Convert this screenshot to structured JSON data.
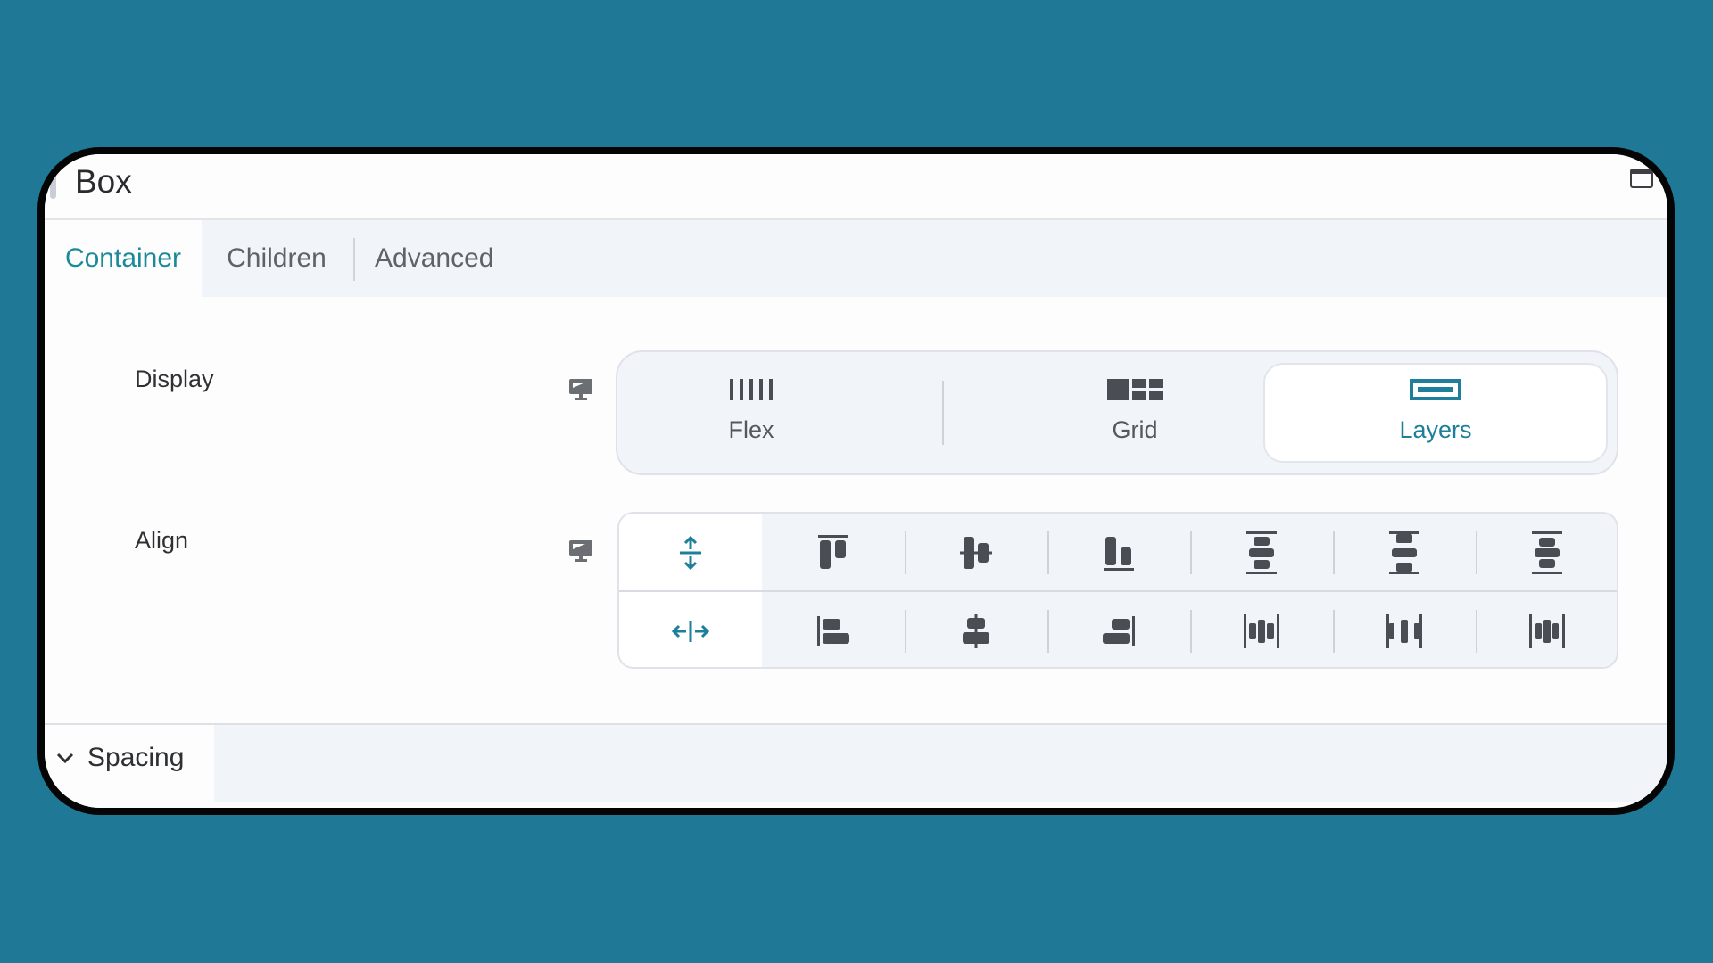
{
  "panel": {
    "title": "Box",
    "window_icon": "window-maximize-icon"
  },
  "tabs": [
    {
      "label": "Container",
      "active": true
    },
    {
      "label": "Children",
      "active": false
    },
    {
      "label": "Advanced",
      "active": false
    }
  ],
  "display": {
    "label": "Display",
    "device_icon": "desktop-monitor-icon",
    "options": [
      {
        "label": "Flex",
        "icon": "flex-columns-icon",
        "active": false
      },
      {
        "label": "Grid",
        "icon": "grid-blocks-icon",
        "active": false
      },
      {
        "label": "Layers",
        "icon": "layers-icon",
        "active": true
      }
    ]
  },
  "align": {
    "label": "Align",
    "device_icon": "desktop-monitor-icon",
    "vertical": [
      {
        "name": "stretch-vertical",
        "icon": "stretch-vertical-icon",
        "active": true
      },
      {
        "name": "align-top",
        "icon": "align-top-icon",
        "active": false
      },
      {
        "name": "align-middle",
        "icon": "align-center-vertical-icon",
        "active": false
      },
      {
        "name": "align-bottom",
        "icon": "align-bottom-icon",
        "active": false
      },
      {
        "name": "space-between-vertical",
        "icon": "space-between-vertical-icon",
        "active": false
      },
      {
        "name": "space-around-vertical",
        "icon": "space-around-vertical-icon",
        "active": false
      },
      {
        "name": "space-evenly-vertical",
        "icon": "space-evenly-vertical-icon",
        "active": false
      }
    ],
    "horizontal": [
      {
        "name": "stretch-horizontal",
        "icon": "stretch-horizontal-icon",
        "active": true
      },
      {
        "name": "align-left",
        "icon": "align-left-icon",
        "active": false
      },
      {
        "name": "align-center",
        "icon": "align-center-horizontal-icon",
        "active": false
      },
      {
        "name": "align-right",
        "icon": "align-right-icon",
        "active": false
      },
      {
        "name": "space-between-horizontal",
        "icon": "space-between-horizontal-icon",
        "active": false
      },
      {
        "name": "space-around-horizontal",
        "icon": "space-around-horizontal-icon",
        "active": false
      },
      {
        "name": "space-evenly-horizontal",
        "icon": "space-evenly-horizontal-icon",
        "active": false
      }
    ]
  },
  "spacing": {
    "label": "Spacing",
    "expanded": false
  },
  "colors": {
    "background": "#1e7896",
    "accent": "#1d7f9b",
    "icon": "#4a4d53"
  }
}
